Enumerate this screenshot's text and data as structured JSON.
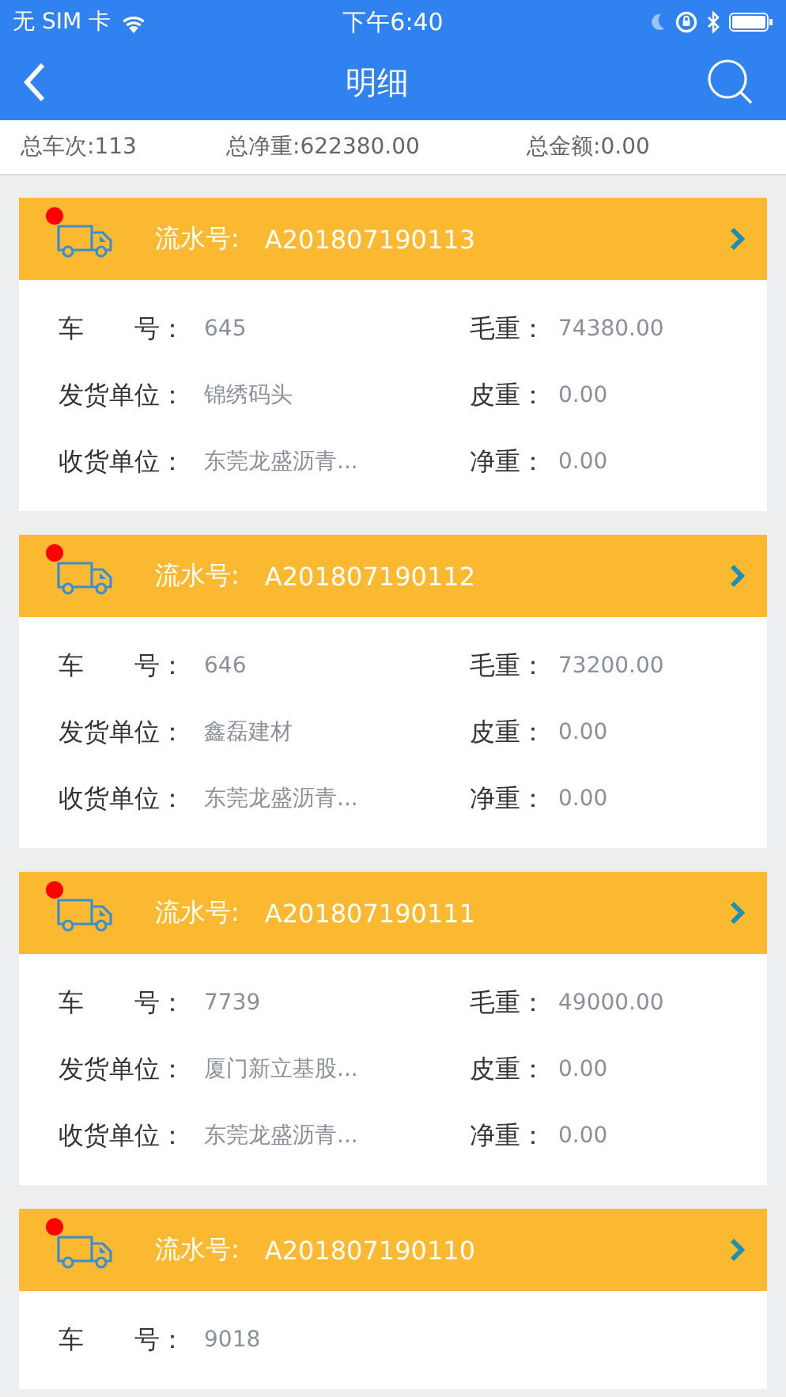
{
  "status_bar": {
    "carrier": "无 SIM 卡",
    "time": "下午6:40"
  },
  "nav": {
    "title": "明细"
  },
  "summary": [
    {
      "text": "总车次:113"
    },
    {
      "text": "总净重:622380.00"
    },
    {
      "text": "总金额:0.00"
    }
  ],
  "cards": [
    {
      "unread": true,
      "serial_label": "流水号:",
      "serial": "A201807190113",
      "left": [
        {
          "label": "车　　号：",
          "value": "645"
        },
        {
          "label": "发货单位：",
          "value": "锦绣码头"
        },
        {
          "label": "收货单位：",
          "value": "东莞龙盛沥青..."
        }
      ],
      "right": [
        {
          "label": "毛重：",
          "value": "74380.00"
        },
        {
          "label": "皮重：",
          "value": "0.00"
        },
        {
          "label": "净重：",
          "value": "0.00"
        }
      ]
    },
    {
      "unread": true,
      "serial_label": "流水号:",
      "serial": "A201807190112",
      "left": [
        {
          "label": "车　　号：",
          "value": "646"
        },
        {
          "label": "发货单位：",
          "value": "鑫磊建材"
        },
        {
          "label": "收货单位：",
          "value": "东莞龙盛沥青..."
        }
      ],
      "right": [
        {
          "label": "毛重：",
          "value": "73200.00"
        },
        {
          "label": "皮重：",
          "value": "0.00"
        },
        {
          "label": "净重：",
          "value": "0.00"
        }
      ]
    },
    {
      "unread": true,
      "serial_label": "流水号:",
      "serial": "A201807190111",
      "left": [
        {
          "label": "车　　号：",
          "value": "7739"
        },
        {
          "label": "发货单位：",
          "value": "厦门新立基股..."
        },
        {
          "label": "收货单位：",
          "value": "东莞龙盛沥青..."
        }
      ],
      "right": [
        {
          "label": "毛重：",
          "value": "49000.00"
        },
        {
          "label": "皮重：",
          "value": "0.00"
        },
        {
          "label": "净重：",
          "value": "0.00"
        }
      ]
    },
    {
      "unread": true,
      "serial_label": "流水号:",
      "serial": "A201807190110",
      "left": [
        {
          "label": "车　　号：",
          "value": "9018"
        }
      ]
    }
  ]
}
